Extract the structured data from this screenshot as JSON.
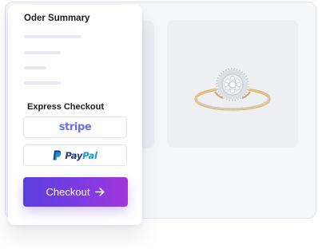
{
  "summary": {
    "title": "Oder Summary"
  },
  "express": {
    "title": "Express Checkout",
    "stripe_label": "stripe",
    "paypal_label_pay": "Pay",
    "paypal_label_pal": "Pal"
  },
  "checkout": {
    "label": "Checkout",
    "icon": "arrow-right-icon"
  },
  "colors": {
    "accent_start": "#5a3ee0",
    "accent_end": "#a236dc",
    "stripe": "#6772e5",
    "paypal_dark": "#253b80",
    "paypal_light": "#179bd7"
  },
  "product": {
    "image": "diamond-halo-ring"
  }
}
